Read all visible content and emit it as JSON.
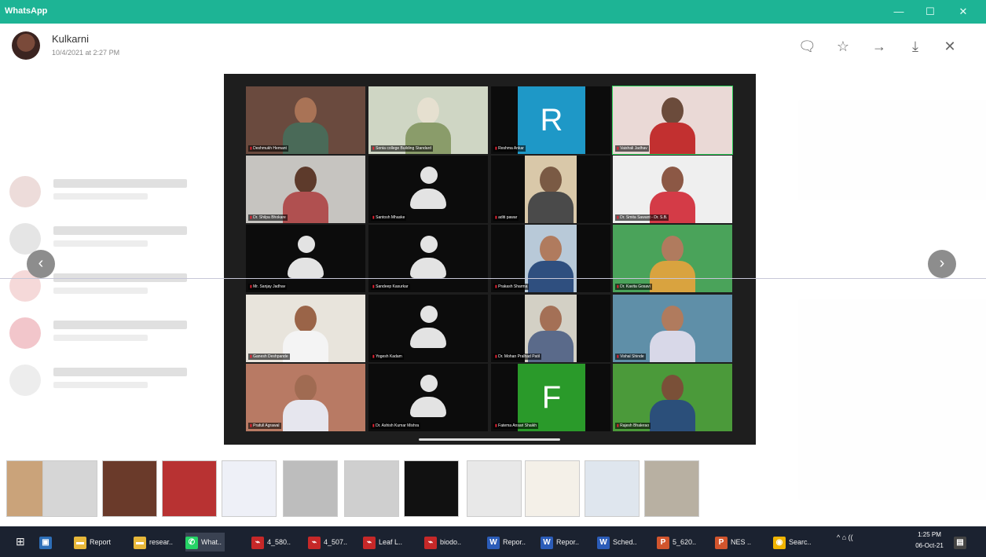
{
  "titlebar": {
    "app_name": "WhatsApp",
    "minimize": "—",
    "maximize": "☐",
    "close": "✕"
  },
  "header": {
    "sender_name": "Kulkarni",
    "timestamp": "10/4/2021 at 2:27 PM",
    "tools": {
      "reply": "🗨",
      "star": "☆",
      "forward": "→",
      "download": "⤓",
      "close": "✕"
    }
  },
  "nav": {
    "prev": "‹",
    "next": "›"
  },
  "media": {
    "participants": [
      {
        "name": "Deshmukh Hemant",
        "kind": "photo",
        "bg": "#6a4a3e",
        "face": "#a97356",
        "torso": "#4a6a58"
      },
      {
        "name": "Sonia college Building Standard",
        "kind": "photo",
        "bg": "#cfd6c4",
        "face": "#e6e0d0",
        "torso": "#8a9c6a"
      },
      {
        "name": "Reshma Ankar",
        "kind": "letter",
        "letter": "R",
        "color": "#1e98c7"
      },
      {
        "name": "Vaishali Jadhav",
        "kind": "photo",
        "bg": "#ead9d6",
        "face": "#6b4b3b",
        "torso": "#c23030",
        "speaking": true
      },
      {
        "name": "Dr. Shilpa Bhokare",
        "kind": "photo",
        "bg": "#c6c4c0",
        "face": "#5d3a2b",
        "torso": "#b05050"
      },
      {
        "name": "Santosh Mhaske",
        "kind": "avatar"
      },
      {
        "name": "aditi pawar",
        "kind": "photo",
        "bg": "#d9c8a9",
        "face": "#7a5a44",
        "torso": "#4a4a4a"
      },
      {
        "name": "Dr. Smita Sawant - Dr. S.B.",
        "kind": "photo",
        "bg": "#efefef",
        "face": "#8c5845",
        "torso": "#d43b47"
      },
      {
        "name": "Mr. Sanjay Jadhav",
        "kind": "avatar"
      },
      {
        "name": "Sandeep Kasurkar",
        "kind": "avatar"
      },
      {
        "name": "Prakash Sharma",
        "kind": "photo",
        "bg": "#b8c9d8",
        "face": "#b07b5e",
        "torso": "#2f4f7f"
      },
      {
        "name": "Dr. Kavita Gosavi",
        "kind": "photo",
        "bg": "#4aa35a",
        "face": "#b07b5e",
        "torso": "#d9a33f"
      },
      {
        "name": "Ganesh Deshpande",
        "kind": "photo",
        "bg": "#e8e4dc",
        "face": "#9a6448",
        "torso": "#f4f4f4"
      },
      {
        "name": "Yogesh Kadam",
        "kind": "avatar"
      },
      {
        "name": "Dr. Mohan Pralhad Patil",
        "kind": "photo",
        "bg": "#d3d0c5",
        "face": "#a47056",
        "torso": "#5a6a8a"
      },
      {
        "name": "Vishal Shinde",
        "kind": "photo",
        "bg": "#5f8fa8",
        "face": "#b07b5e",
        "torso": "#d8d8e8"
      },
      {
        "name": "Prafull Agrawal",
        "kind": "photo",
        "bg": "#b87a64",
        "face": "#a06b52",
        "torso": "#e6e6ee"
      },
      {
        "name": "Dr. Ashish Kumar Mishra",
        "kind": "avatar"
      },
      {
        "name": "Fatema Ansari Shaikh",
        "kind": "letter",
        "letter": "F",
        "color": "#2a9a2a"
      },
      {
        "name": "Rajesh Bhalerao",
        "kind": "photo",
        "bg": "#4b9a3a",
        "face": "#7a5038",
        "torso": "#2b4f7a"
      }
    ]
  },
  "thumbnails": [
    {
      "label": "thumbnail-1",
      "color": "#caa37a"
    },
    {
      "label": "thumbnail-2",
      "color": "#d6d6d6"
    },
    {
      "label": "thumbnail-3",
      "color": "#6a3a2a"
    },
    {
      "label": "thumbnail-4",
      "color": "#b83232"
    },
    {
      "label": "thumbnail-5",
      "color": "#eef0f7"
    },
    {
      "label": "thumbnail-6",
      "color": "#bdbdbd"
    },
    {
      "label": "thumbnail-7",
      "color": "#cfcfcf"
    },
    {
      "label": "thumbnail-8",
      "color": "#111111"
    },
    {
      "label": "thumbnail-9",
      "color": "#e8e8e8"
    },
    {
      "label": "thumbnail-10",
      "color": "#f4f0e8"
    },
    {
      "label": "thumbnail-11",
      "color": "#dfe6ee"
    },
    {
      "label": "thumbnail-12",
      "color": "#b8b0a2"
    }
  ],
  "taskbar": {
    "items": [
      {
        "label": "Report",
        "icon": "folder",
        "color": "#e8b83a"
      },
      {
        "label": "resear..",
        "icon": "folder",
        "color": "#e8b83a"
      },
      {
        "label": "What..",
        "icon": "whatsapp",
        "color": "#25d366",
        "active": true
      },
      {
        "label": "4_580..",
        "icon": "pdf",
        "color": "#c62828"
      },
      {
        "label": "4_507..",
        "icon": "pdf",
        "color": "#c62828"
      },
      {
        "label": "Leaf L..",
        "icon": "pdf",
        "color": "#c62828"
      },
      {
        "label": "biodo..",
        "icon": "pdf",
        "color": "#c62828"
      },
      {
        "label": "Repor..",
        "icon": "word",
        "color": "#2b5cb8"
      },
      {
        "label": "Repor..",
        "icon": "word",
        "color": "#2b5cb8"
      },
      {
        "label": "Sched..",
        "icon": "word",
        "color": "#2b5cb8"
      },
      {
        "label": "5_620..",
        "icon": "ppt",
        "color": "#d2552d"
      },
      {
        "label": "NES ..",
        "icon": "ppt",
        "color": "#d2552d"
      },
      {
        "label": "Searc..",
        "icon": "chrome",
        "color": "#f0b400"
      }
    ],
    "tray": "^ ⌂ ((",
    "time": "1:25 PM",
    "date": "06-Oct-21"
  }
}
